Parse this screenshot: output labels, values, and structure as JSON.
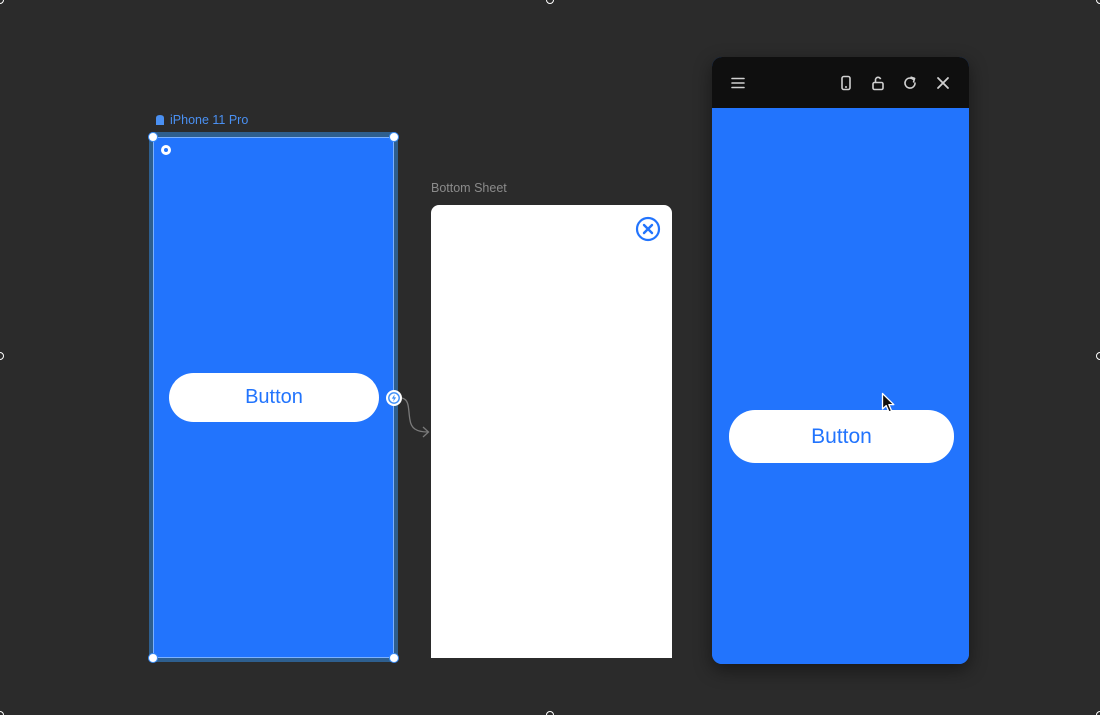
{
  "frames": {
    "iphone": {
      "label": "iPhone 11 Pro",
      "button_label": "Button"
    },
    "bottom_sheet": {
      "label": "Bottom Sheet"
    }
  },
  "preview": {
    "toolbar": {
      "icons": [
        "menu-icon",
        "device-icon",
        "unlock-icon",
        "reload-icon",
        "close-icon"
      ]
    },
    "button_label": "Button"
  },
  "colors": {
    "canvas": "#2b2b2b",
    "accent_blue": "#2274fd",
    "selection_blue": "#3d8ef7",
    "toolbar": "#0f0f0f",
    "sheet": "#ffffff"
  }
}
